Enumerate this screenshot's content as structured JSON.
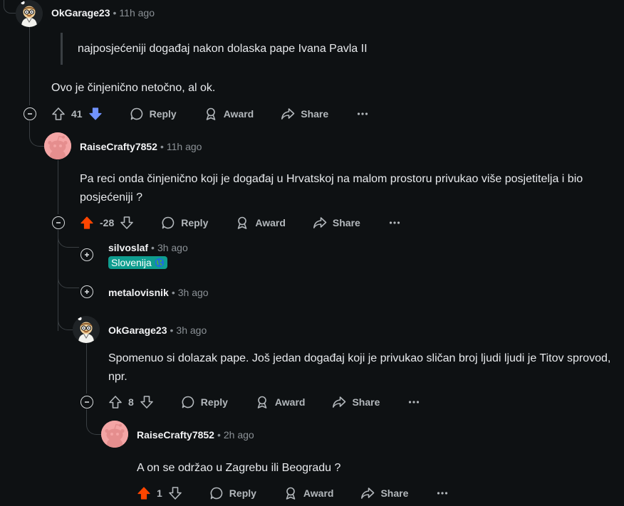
{
  "comments": [
    {
      "author": "OkGarage23",
      "time": "11h ago",
      "quote": "najposjećeniji događaj nakon dolaska pape Ivana Pavla II",
      "text": "Ovo je činjenično netočno, al ok.",
      "score": "41",
      "vote_state": "downvoted"
    },
    {
      "author": "RaiseCrafty7852",
      "time": "11h ago",
      "text": "Pa reci onda činjenično koji je događaj u Hrvatskoj na malom prostoru privukao više posjetitelja i bio posjećeniji ?",
      "score": "-28",
      "vote_state": "upvoted"
    },
    {
      "author": "silvoslaf",
      "time": "3h ago",
      "flair": "Slovenija",
      "collapsed": true
    },
    {
      "author": "metalovisnik",
      "time": "3h ago",
      "collapsed": true
    },
    {
      "author": "OkGarage23",
      "time": "3h ago",
      "text": "Spomenuo si dolazak pape. Još jedan događaj koji je privukao sličan broj ljudi ljudi je Titov sprovod, npr.",
      "score": "8",
      "vote_state": "none"
    },
    {
      "author": "RaiseCrafty7852",
      "time": "2h ago",
      "text": "A on se održao u Zagrebu ili Beogradu ?",
      "score": "1",
      "vote_state": "upvoted"
    }
  ],
  "actions": {
    "reply": "Reply",
    "award": "Award",
    "share": "Share",
    "more": "···"
  },
  "colors": {
    "background": "#0e1113",
    "upvote_active": "#ff4500",
    "downvote_active": "#7193ff",
    "flair_bg": "#0f9d8f"
  },
  "icons": [
    "upvote-icon",
    "downvote-icon",
    "reply-bubble-icon",
    "award-icon",
    "share-icon",
    "more-icon",
    "collapse-minus-icon",
    "expand-plus-icon",
    "globe-icon"
  ]
}
